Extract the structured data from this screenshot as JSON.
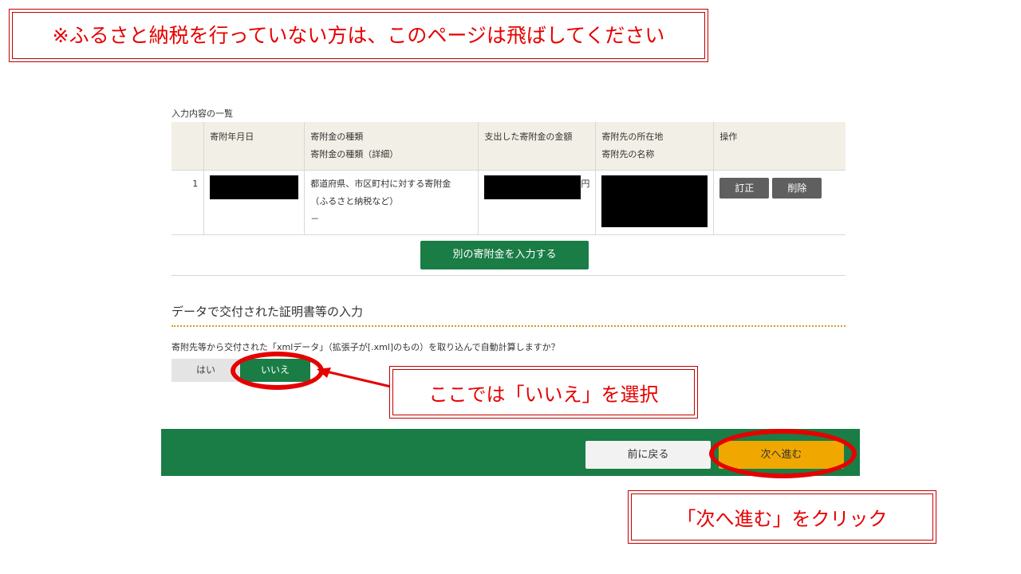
{
  "annotations": {
    "top_notice": "※ふるさと納税を行っていない方は、このページは飛ばしてください",
    "iie_hint": "ここでは「いいえ」を選択",
    "next_hint": "「次へ進む」をクリック"
  },
  "list": {
    "title": "入力内容の一覧",
    "headers": {
      "date": "寄附年月日",
      "type": "寄附金の種類",
      "type_detail": "寄附金の種類（詳細）",
      "amount": "支出した寄附金の金額",
      "location": "寄附先の所在地",
      "name": "寄附先の名称",
      "operation": "操作"
    },
    "rows": [
      {
        "no": "1",
        "type_line1": "都道府県、市区町村に対する寄附金",
        "type_line2": "（ふるさと納税など）",
        "type_detail": "－",
        "amount_unit": "円",
        "edit_label": "訂正",
        "delete_label": "削除"
      }
    ],
    "add_button": "別の寄附金を入力する"
  },
  "data_section": {
    "title": "データで交付された証明書等の入力",
    "question": "寄附先等から交付された「xmlデータ」（拡張子が[.xml]のもの）を取り込んで自動計算しますか？",
    "yes_label": "はい",
    "no_label": "いいえ",
    "selected": "いいえ"
  },
  "footer": {
    "back_label": "前に戻る",
    "next_label": "次へ進む"
  },
  "colors": {
    "accent_green": "#1a7d46",
    "next_orange": "#f0a800",
    "annotation_red": "#e60000"
  }
}
